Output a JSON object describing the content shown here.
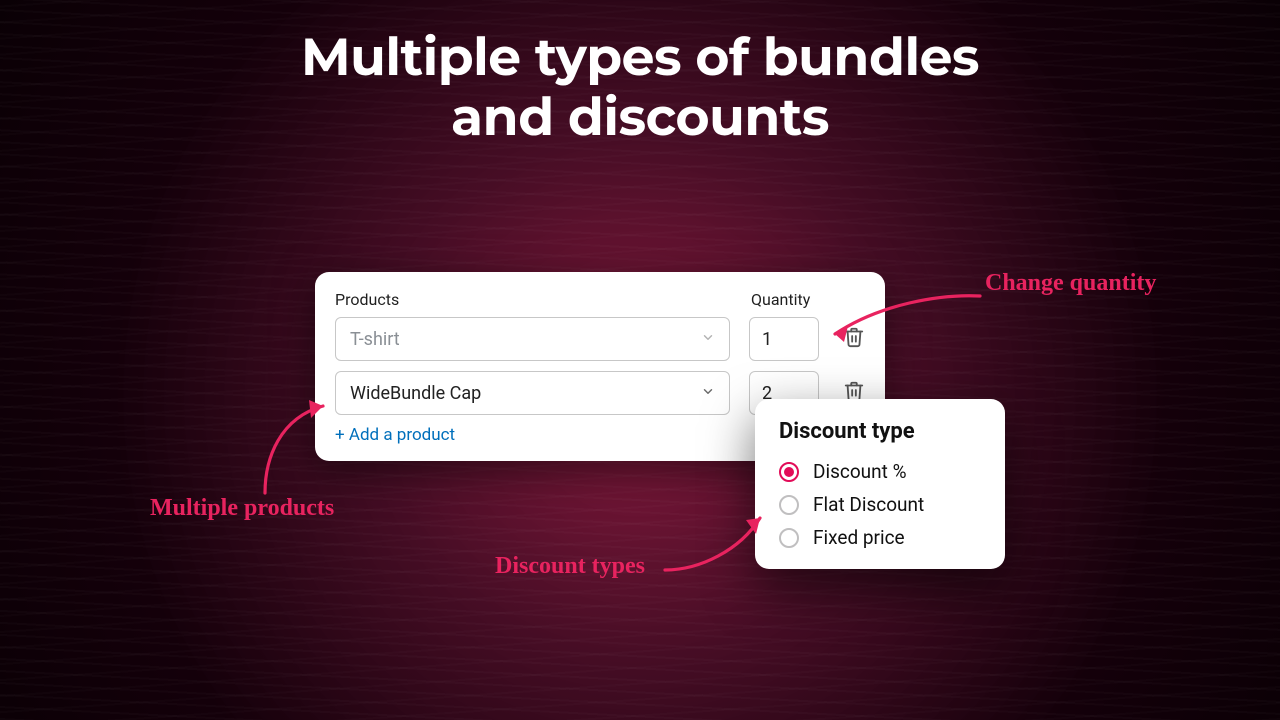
{
  "headline_line1": "Multiple types of bundles",
  "headline_line2": "and discounts",
  "products_card": {
    "label_products": "Products",
    "label_quantity": "Quantity",
    "rows": [
      {
        "name": "T-shirt",
        "placeholder": true,
        "qty": "1"
      },
      {
        "name": "WideBundle Cap",
        "placeholder": false,
        "qty": "2"
      }
    ],
    "add_label": "+ Add a product"
  },
  "discount_card": {
    "title": "Discount type",
    "options": [
      {
        "label": "Discount %",
        "checked": true
      },
      {
        "label": "Flat Discount",
        "checked": false
      },
      {
        "label": "Fixed price",
        "checked": false
      }
    ]
  },
  "annotations": {
    "change_quantity": "Change quantity",
    "multiple_products": "Multiple products",
    "discount_types": "Discount types"
  },
  "colors": {
    "accent": "#e8235f",
    "link": "#006fbb"
  }
}
